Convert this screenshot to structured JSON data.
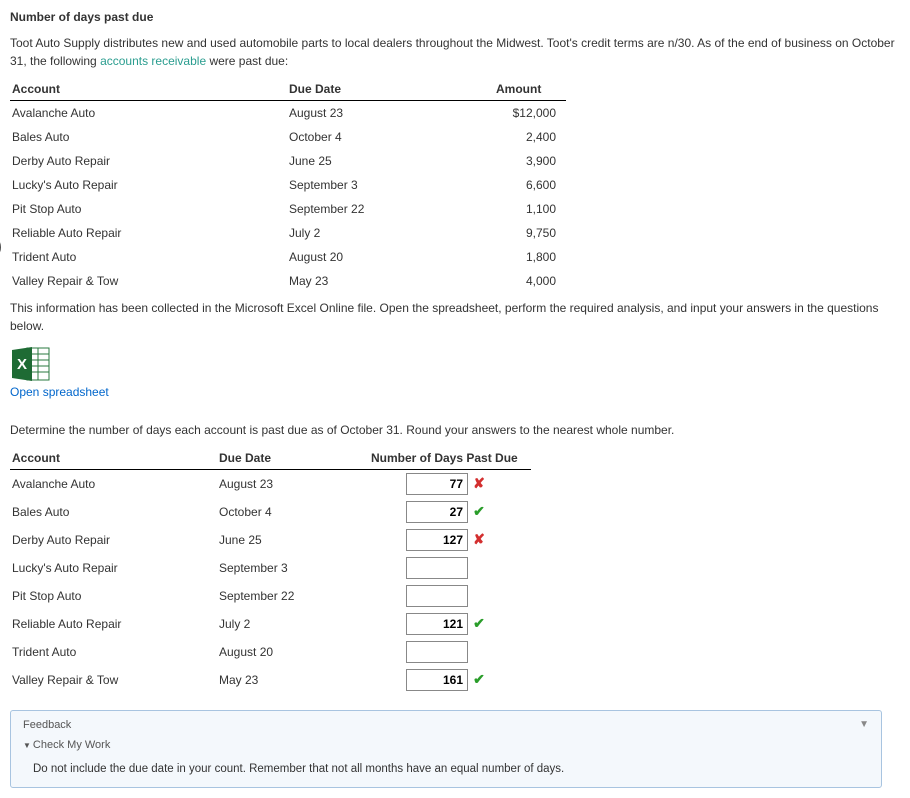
{
  "title": "Number of days past due",
  "intro_pre": "Toot Auto Supply distributes new and used automobile parts to local dealers throughout the Midwest. Toot's credit terms are n/30. As of the end of business on October 31, the following ",
  "intro_link": "accounts receivable",
  "intro_post": " were past due:",
  "table1": {
    "headers": {
      "account": "Account",
      "due": "Due Date",
      "amount": "Amount"
    },
    "rows": [
      {
        "account": "Avalanche Auto",
        "due": "August 23",
        "amount": "$12,000"
      },
      {
        "account": "Bales Auto",
        "due": "October 4",
        "amount": "2,400"
      },
      {
        "account": "Derby Auto Repair",
        "due": "June 25",
        "amount": "3,900"
      },
      {
        "account": "Lucky's Auto Repair",
        "due": "September 3",
        "amount": "6,600"
      },
      {
        "account": "Pit Stop Auto",
        "due": "September 22",
        "amount": "1,100"
      },
      {
        "account": "Reliable Auto Repair",
        "due": "July 2",
        "amount": "9,750"
      },
      {
        "account": "Trident Auto",
        "due": "August 20",
        "amount": "1,800"
      },
      {
        "account": "Valley Repair & Tow",
        "due": "May 23",
        "amount": "4,000"
      }
    ]
  },
  "after_table_text": "This information has been collected in the Microsoft Excel Online file. Open the spreadsheet, perform the required analysis, and input your answers in the questions below.",
  "open_link_text": "Open spreadsheet",
  "instruction": "Determine the number of days each account is past due as of October 31. Round your answers to the nearest whole number.",
  "table2": {
    "headers": {
      "account": "Account",
      "due": "Due Date",
      "num": "Number of Days Past Due"
    },
    "rows": [
      {
        "account": "Avalanche Auto",
        "due": "August 23",
        "value": "77",
        "mark": "wrong"
      },
      {
        "account": "Bales Auto",
        "due": "October 4",
        "value": "27",
        "mark": "correct"
      },
      {
        "account": "Derby Auto Repair",
        "due": "June 25",
        "value": "127",
        "mark": "wrong"
      },
      {
        "account": "Lucky's Auto Repair",
        "due": "September 3",
        "value": "",
        "mark": ""
      },
      {
        "account": "Pit Stop Auto",
        "due": "September 22",
        "value": "",
        "mark": ""
      },
      {
        "account": "Reliable Auto Repair",
        "due": "July 2",
        "value": "121",
        "mark": "correct"
      },
      {
        "account": "Trident Auto",
        "due": "August 20",
        "value": "",
        "mark": ""
      },
      {
        "account": "Valley Repair & Tow",
        "due": "May 23",
        "value": "161",
        "mark": "correct"
      }
    ]
  },
  "feedback": {
    "label": "Feedback",
    "check_label": "Check My Work",
    "body": "Do not include the due date in your count. Remember that not all months have an equal number of days."
  },
  "icons": {
    "mark_correct": "✔",
    "mark_wrong": "✘",
    "chevron_down": "▼",
    "tri": "▼"
  }
}
